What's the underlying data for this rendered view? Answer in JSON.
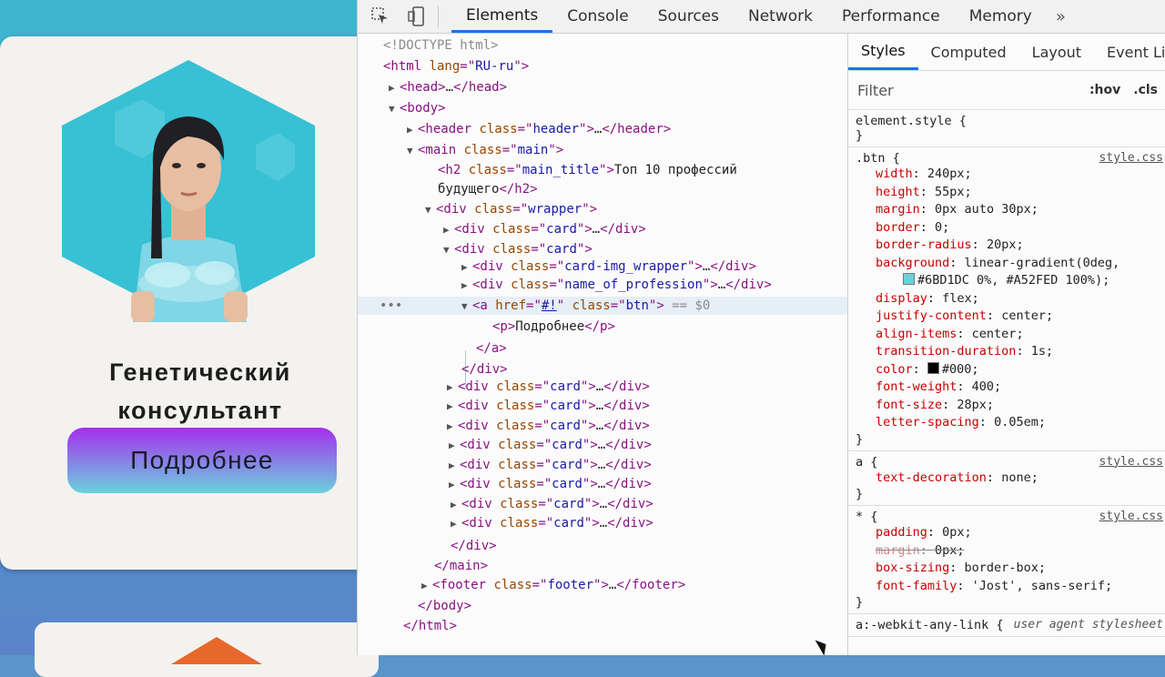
{
  "preview": {
    "card_title_line1": "Генетический",
    "card_title_line2": "консультант",
    "card_button": "Подробнее",
    "colors": {
      "grad_start": "#6BD1DC",
      "grad_end": "#A52FED",
      "hex_bg": "#38c0d4",
      "accent_orange": "#e8672a"
    }
  },
  "devtools": {
    "icons": [
      "inspect-icon",
      "device-toolbar-icon"
    ],
    "tabs": [
      "Elements",
      "Console",
      "Sources",
      "Network",
      "Performance",
      "Memory"
    ],
    "tabs_more": "»",
    "tree": {
      "doctype": "<!DOCTYPE html>",
      "html_lang": "RU-ru",
      "h2_text_line1": "Топ 10 профессий",
      "h2_text_line2": "будущего",
      "p_text": "Подробнее",
      "href": "#!",
      "selected_marker": "== $0"
    },
    "styles": {
      "tabs": [
        "Styles",
        "Computed",
        "Layout",
        "Event Listeners"
      ],
      "filter_label": "Filter",
      "filter_hov": ":hov",
      "filter_cls": ".cls",
      "source_link": "style.css",
      "user_agent_label": "user agent stylesheet",
      "rules": [
        {
          "selector": "element.style {",
          "declarations": []
        },
        {
          "selector": ".btn {",
          "declarations": [
            {
              "prop": "width",
              "value": "240px;"
            },
            {
              "prop": "height",
              "value": "55px;"
            },
            {
              "prop": "margin",
              "value": "0px auto 30px;"
            },
            {
              "prop": "border",
              "value": "0;"
            },
            {
              "prop": "border-radius",
              "value": "20px;"
            },
            {
              "prop": "background",
              "value": "linear-gradient(0deg,"
            },
            {
              "prop": "",
              "value": "#6BD1DC 0%, #A52FED 100%);"
            },
            {
              "prop": "display",
              "value": "flex;"
            },
            {
              "prop": "justify-content",
              "value": "center;"
            },
            {
              "prop": "align-items",
              "value": "center;"
            },
            {
              "prop": "transition-duration",
              "value": "1s;"
            },
            {
              "prop": "color",
              "value": "#000;"
            },
            {
              "prop": "font-weight",
              "value": "400;"
            },
            {
              "prop": "font-size",
              "value": "28px;"
            },
            {
              "prop": "letter-spacing",
              "value": "0.05em;"
            }
          ]
        },
        {
          "selector": "a {",
          "declarations": [
            {
              "prop": "text-decoration",
              "value": "none;"
            }
          ]
        },
        {
          "selector": "* {",
          "declarations": [
            {
              "prop": "padding",
              "value": "0px;"
            },
            {
              "prop": "margin",
              "value": "0px;"
            },
            {
              "prop": "box-sizing",
              "value": "border-box;"
            },
            {
              "prop": "font-family",
              "value": "'Jost', sans-serif;"
            }
          ]
        },
        {
          "selector": "a:-webkit-any-link {",
          "declarations": []
        }
      ],
      "closing_brace": "}"
    }
  }
}
